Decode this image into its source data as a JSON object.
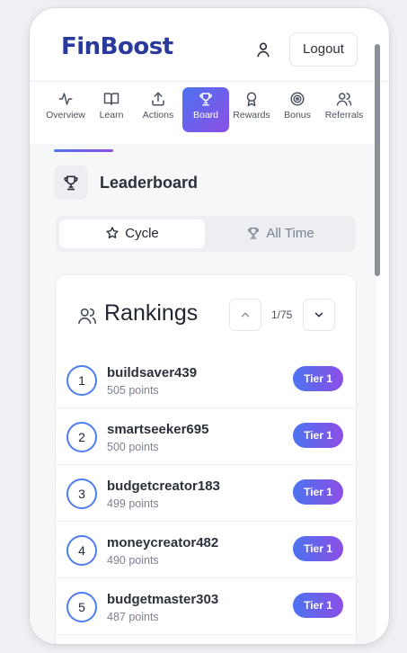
{
  "header": {
    "logo": "FinBoost",
    "logout_label": "Logout"
  },
  "nav": {
    "items": [
      {
        "label": "Overview",
        "icon": "activity-icon"
      },
      {
        "label": "Learn",
        "icon": "book-icon"
      },
      {
        "label": "Actions",
        "icon": "upload-icon"
      },
      {
        "label": "Board",
        "icon": "trophy-icon",
        "active": true
      },
      {
        "label": "Rewards",
        "icon": "award-icon"
      },
      {
        "label": "Bonus",
        "icon": "target-icon"
      },
      {
        "label": "Referrals",
        "icon": "users-icon"
      }
    ]
  },
  "leaderboard": {
    "title": "Leaderboard",
    "tabs": [
      {
        "label": "Cycle",
        "icon": "star-icon",
        "selected": true
      },
      {
        "label": "All Time",
        "icon": "trophy-icon",
        "selected": false
      }
    ]
  },
  "rankings": {
    "title": "Rankings",
    "page": "1/75",
    "rows": [
      {
        "rank": "1",
        "username": "buildsaver439",
        "points": "505 points",
        "tier": "Tier 1"
      },
      {
        "rank": "2",
        "username": "smartseeker695",
        "points": "500 points",
        "tier": "Tier 1"
      },
      {
        "rank": "3",
        "username": "budgetcreator183",
        "points": "499 points",
        "tier": "Tier 1"
      },
      {
        "rank": "4",
        "username": "moneycreator482",
        "points": "490 points",
        "tier": "Tier 1"
      },
      {
        "rank": "5",
        "username": "budgetmaster303",
        "points": "487 points",
        "tier": "Tier 1"
      }
    ]
  },
  "colors": {
    "brand": "#2a3a9c",
    "accent_start": "#4c73f0",
    "accent_end": "#8d4ee6"
  }
}
